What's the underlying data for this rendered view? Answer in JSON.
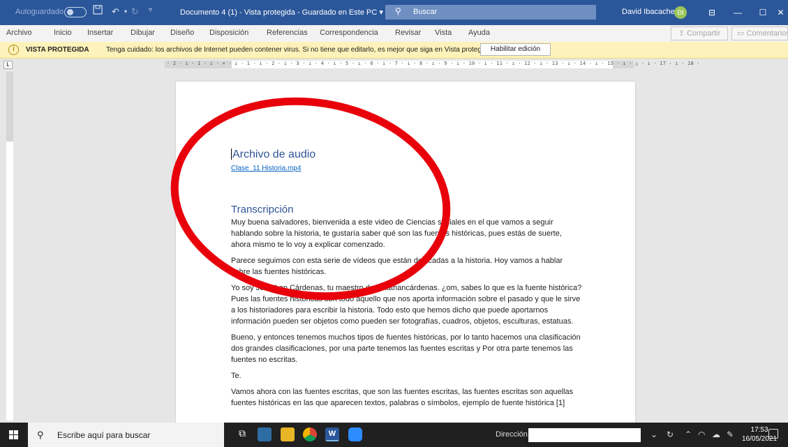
{
  "titlebar": {
    "autosave_label": "Autoguardado",
    "save_icon": "save-icon",
    "undo_icon": "undo-icon",
    "redo_icon": "redo-icon",
    "customize_icon": "customize-qat-icon",
    "document_title": "Documento 4 (1)  -  Vista protegida  -  Guardado en Este PC",
    "title_dropdown": "▾",
    "search_placeholder": "Buscar",
    "user_name": "David Ibacache",
    "user_initials": "DI",
    "accent": "#2b579a"
  },
  "menu": {
    "items": [
      "Archivo",
      "Inicio",
      "Insertar",
      "Dibujar",
      "Diseño",
      "Disposición",
      "Referencias",
      "Correspondencia",
      "Revisar",
      "Vista",
      "Ayuda"
    ],
    "share_label": "Compartir",
    "comments_label": "Comentarios"
  },
  "protected_view": {
    "title": "VISTA PROTEGIDA",
    "message": "Tenga cuidado: los archivos de Internet pueden contener virus. Si no tiene que editarlo, es mejor que siga en Vista protegida.",
    "enable_button": "Habilitar edición",
    "background": "#fdf2b9"
  },
  "ruler": {
    "tab_selector": "L",
    "scale": "· 2 · ı · 1 · ı · ⨯ · ı · 1 · ı · 2 · ı · 3 · ı · 4 · ı · 5 · ı · 6 · ı · 7 · ı · 8 · ı · 9 · ı · 10 · ı · 11 · ı · 12 · ı · 13 · ı · 14 · ı · 15 · ı · △ · ı · 17 · ı · 18 ·"
  },
  "document": {
    "heading1": "Archivo de audio",
    "audio_link": "Clase_11 Historia.mp4",
    "heading2": "Transcripción",
    "paragraphs": [
      "Muy buena salvadores, bienvenida a este video de Ciencias sociales en el que vamos a seguir hablando sobre la historia, te gustaría saber qué son las fuentes históricas, pues estás de suerte, ahora mismo te lo voy a explicar comenzado.",
      "Parece seguimos con esta serie de vídeos que están dedicadas a la historia. Hoy vamos a hablar sobre las fuentes históricas.",
      "Yo soy Jonathan Cárdenas, tu maestro de jonathancárdenas. ¿om, sabes lo que es la fuente histórica? Pues las fuentes históricas son todo aquello que nos aporta información sobre el pasado y que le sirve a los historiadores para escribir la historia. Todo esto que hemos dicho que puede aportarnos información pueden ser objetos como pueden ser fotografías, cuadros, objetos, esculturas, estatuas.",
      "Bueno, y entonces tenemos muchos tipos de fuentes históricas, por lo tanto hacemos una clasificación dos grandes clasificaciones, por una parte tenemos las fuentes escritas y Por otra parte tenemos las fuentes no escritas.",
      "Te.",
      "Vamos ahora con las fuentes escritas, que son las fuentes escritas, las fuentes escritas son aquellas fuentes históricas en las que aparecen textos, palabras o símbolos, ejemplo de fuente histórica [1]"
    ]
  },
  "annotation": {
    "shape": "ellipse",
    "color": "#e8000b"
  },
  "taskbar": {
    "start_icon": "windows-logo-icon",
    "search_placeholder": "Escribe aquí para buscar",
    "apps": [
      "task-view-icon",
      "calculator-icon",
      "file-explorer-icon",
      "chrome-icon",
      "word-icon",
      "zoom-icon"
    ],
    "address_label": "Dirección",
    "time": "17:53",
    "date": "16/05/2021"
  }
}
